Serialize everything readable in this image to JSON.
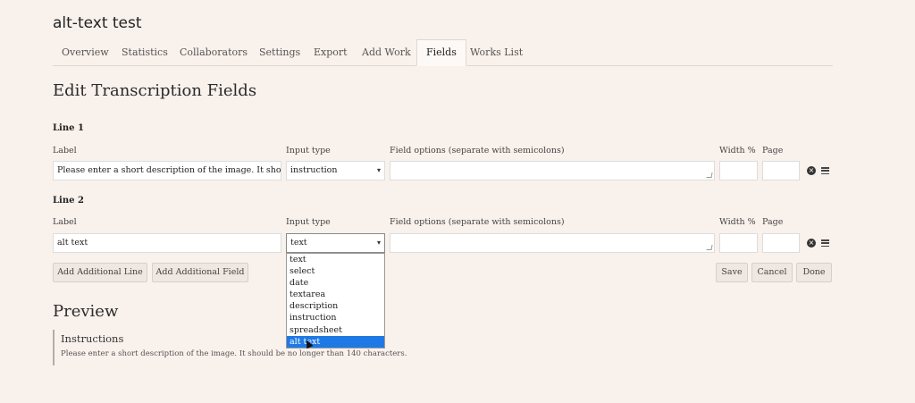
{
  "project_title": "alt-text test",
  "tabs": [
    "Overview",
    "Statistics",
    "Collaborators",
    "Settings",
    "Export",
    "Add Work",
    "Fields",
    "Works List"
  ],
  "active_tab": "Fields",
  "page_heading": "Edit Transcription Fields",
  "column_labels": {
    "label": "Label",
    "input_type": "Input type",
    "field_options": "Field options (separate with semicolons)",
    "width": "Width %",
    "page": "Page"
  },
  "lines": [
    {
      "heading": "Line 1",
      "label_value": "Please enter a short description of the image.  It should",
      "input_type": "instruction",
      "field_options": "",
      "width": "",
      "page": ""
    },
    {
      "heading": "Line 2",
      "label_value": "alt text",
      "input_type": "text",
      "field_options": "",
      "width": "",
      "page": ""
    }
  ],
  "buttons": {
    "add_line": "Add Additional Line",
    "add_field": "Add Additional Field",
    "save": "Save",
    "cancel": "Cancel",
    "done": "Done"
  },
  "input_type_options": [
    "text",
    "select",
    "date",
    "textarea",
    "description",
    "instruction",
    "spreadsheet",
    "alt text"
  ],
  "highlighted_option": "alt text",
  "preview": {
    "heading": "Preview",
    "title": "Instructions",
    "text": "Please enter a short description of the image. It should be no longer than 140 characters."
  },
  "icons": {
    "remove": "remove-circle-icon",
    "reorder": "reorder-handle-icon"
  },
  "colors": {
    "background": "#f9f1ec",
    "highlight": "#1e79e5"
  }
}
